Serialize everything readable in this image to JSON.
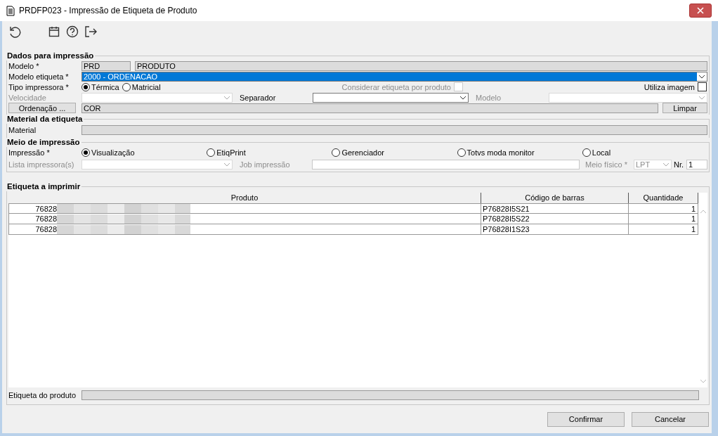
{
  "window": {
    "title": "PRDFP023 - Impressão de Etiqueta de Produto"
  },
  "toolbar": [
    {
      "kind": "refresh"
    },
    {
      "kind": "calendar"
    },
    {
      "kind": "help"
    },
    {
      "kind": "exit"
    }
  ],
  "dados": {
    "title": "Dados para impressão",
    "modelo": {
      "label": "Modelo *",
      "code": "PRD",
      "name": "PRODUTO"
    },
    "modelo_etiqueta": {
      "label": "Modelo etiqueta *",
      "value": "2000 - ORDENACAO",
      "highlighted": true
    },
    "tipo_impressora": {
      "label": "Tipo impressora *",
      "options": [
        {
          "label": "Térmica",
          "selected": true
        },
        {
          "label": "Matricial",
          "selected": false
        }
      ]
    },
    "considerar": {
      "label": "Considerar etiqueta por produto",
      "checked": false,
      "disabled": true
    },
    "utiliza_imagem": {
      "label": "Utiliza imagem",
      "checked": false,
      "disabled": false
    },
    "velocidade": {
      "label": "Velocidade",
      "disabled": true
    },
    "separador": {
      "label": "Separador",
      "disabled": false
    },
    "modelo2": {
      "label": "Modelo",
      "disabled": true
    },
    "ordenacao": {
      "button": "Ordenação ...",
      "value": "COR",
      "clear": "Limpar"
    }
  },
  "material": {
    "title": "Material da etiqueta",
    "label": "Material"
  },
  "meio": {
    "title": "Meio de impressão",
    "label": "Impressão *",
    "options": [
      {
        "label": "Visualização",
        "selected": true
      },
      {
        "label": "EtiqPrint",
        "selected": false
      },
      {
        "label": "Gerenciador",
        "selected": false
      },
      {
        "label": "Totvs moda monitor",
        "selected": false
      },
      {
        "label": "Local",
        "selected": false
      }
    ],
    "lista": {
      "label": "Lista impressora(s)",
      "disabled": true
    },
    "job": {
      "label": "Job impressão",
      "disabled": true
    },
    "meio_fisico": {
      "label": "Meio físico *",
      "value": "LPT",
      "disabled": true
    },
    "nr": {
      "label": "Nr.",
      "value": "1"
    }
  },
  "etiquetas": {
    "title": "Etiqueta a imprimir",
    "columns": [
      "Produto",
      "Código de barras",
      "Quantidade"
    ],
    "rows": [
      {
        "code": "76828",
        "barcode": "P76828I5S21",
        "qty": "1"
      },
      {
        "code": "76828",
        "barcode": "P76828I5S22",
        "qty": "1"
      },
      {
        "code": "76828",
        "barcode": "P76828I1S23",
        "qty": "1"
      }
    ],
    "footer_label": "Etiqueta do produto"
  },
  "buttons": [
    "Confirmar",
    "Cancelar"
  ]
}
